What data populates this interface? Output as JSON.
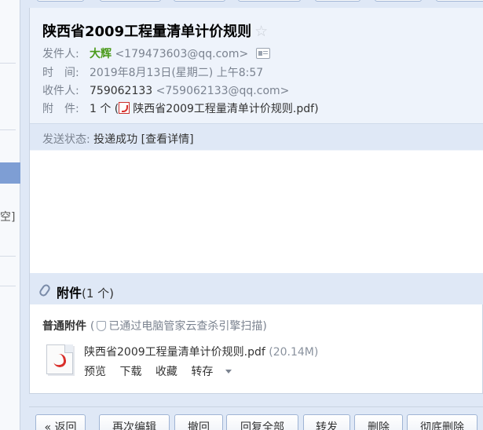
{
  "sidebar": {
    "fragment_text": "空]"
  },
  "mail": {
    "subject": "陕西省2009工程量清单计价规则",
    "star_icon": "star-icon",
    "sender": {
      "label": "发件人:",
      "name": "大辉",
      "email": "<179473603@qq.com>"
    },
    "time": {
      "label": "时　间:",
      "value": "2019年8月13日(星期二) 上午8:57"
    },
    "recipient": {
      "label": "收件人:",
      "name": "759062133",
      "email": "<759062133@qq.com>"
    },
    "attachment_summary": {
      "label": "附　件:",
      "count": "1 个 (",
      "file": "陕西省2009工程量清单计价规则.pdf",
      "close": ")"
    },
    "send_status": {
      "label": "发送状态:",
      "value": "投递成功",
      "details": "[查看详情]"
    }
  },
  "attachments": {
    "title": "附件",
    "count": "(1 个)",
    "kind_label": "普通附件",
    "scan_open": "(",
    "scan_text": "已通过电脑管家云查杀引擎扫描)",
    "file": {
      "name": "陕西省2009工程量清单计价规则.pdf",
      "size": "(20.14M)",
      "actions": {
        "preview": "预览",
        "download": "下载",
        "favorite": "收藏",
        "save": "转存"
      }
    }
  },
  "toolbar": {
    "back": "« 返回",
    "edit_again": "再次编辑",
    "recall": "撤回",
    "reply_all": "回复全部",
    "forward": "转发",
    "delete": "删除",
    "delete_permanently": "彻底删除"
  }
}
